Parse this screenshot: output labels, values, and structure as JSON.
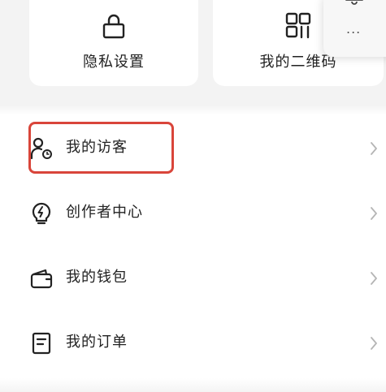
{
  "quick_actions": [
    {
      "label": "隐私设置",
      "icon": "lock-icon"
    },
    {
      "label": "我的二维码",
      "icon": "qr-code-icon"
    }
  ],
  "capsule": {
    "bell_icon": "bell-icon",
    "more_label": "..."
  },
  "menu": {
    "items": [
      {
        "label": "我的访客",
        "icon": "visitor-icon",
        "highlighted": true
      },
      {
        "label": "创作者中心",
        "icon": "lightbulb-icon",
        "highlighted": false
      },
      {
        "label": "我的钱包",
        "icon": "wallet-icon",
        "highlighted": false
      },
      {
        "label": "我的订单",
        "icon": "order-list-icon",
        "highlighted": false
      }
    ]
  },
  "colors": {
    "highlight_border": "#d9453a",
    "panel_background": "#f3f3f3",
    "icon_stroke": "#222222",
    "chevron": "#b5b5b5"
  }
}
